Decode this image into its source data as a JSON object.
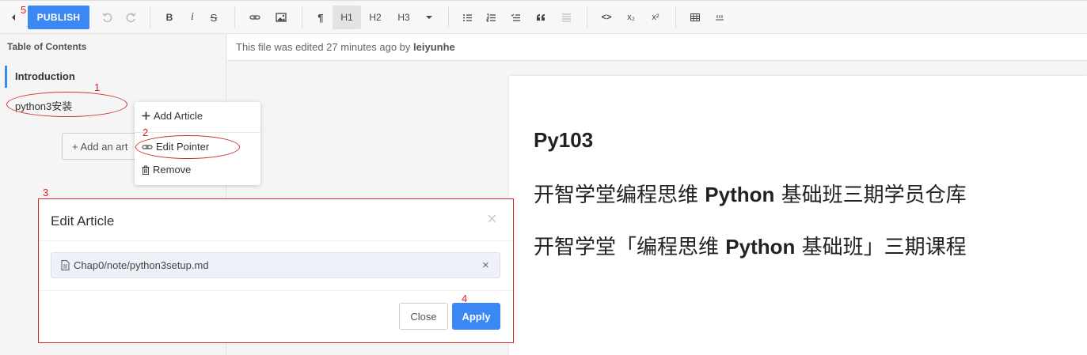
{
  "toolbar": {
    "publish_label": "PUBLISH",
    "h1": "H1",
    "h2": "H2",
    "h3": "H3",
    "bold": "B",
    "italic": "i",
    "strike": "S",
    "paragraph": "¶",
    "code": "<>",
    "subscript": "x₂",
    "superscript": "x²"
  },
  "sidebar": {
    "title": "Table of Contents",
    "active_item": "Introduction",
    "items": [
      {
        "label": "python3安装"
      }
    ],
    "add_button": "+ Add an art"
  },
  "infobar": {
    "prefix": "This file was edited 27 minutes ago by ",
    "user": "leiyunhe"
  },
  "page": {
    "heading": "Py103",
    "line1_pre": "开智学堂编程思维 ",
    "line1_bold": "Python",
    "line1_post": " 基础班三期学员仓库",
    "line2_pre": "开智学堂「编程思维 ",
    "line2_bold": "Python",
    "line2_post": " 基础班」三期课程"
  },
  "context_menu": {
    "add_article": "Add Article",
    "edit_pointer": "Edit Pointer",
    "remove": "Remove"
  },
  "modal": {
    "title": "Edit Article",
    "close_x": "×",
    "file_path": "Chap0/note/python3setup.md",
    "clear_x": "×",
    "close_button": "Close",
    "apply_button": "Apply"
  },
  "annotations": {
    "n1": "1",
    "n2": "2",
    "n3": "3",
    "n4": "4",
    "n5": "5"
  },
  "colors": {
    "accent": "#3b88f5",
    "annotation": "#d22"
  }
}
